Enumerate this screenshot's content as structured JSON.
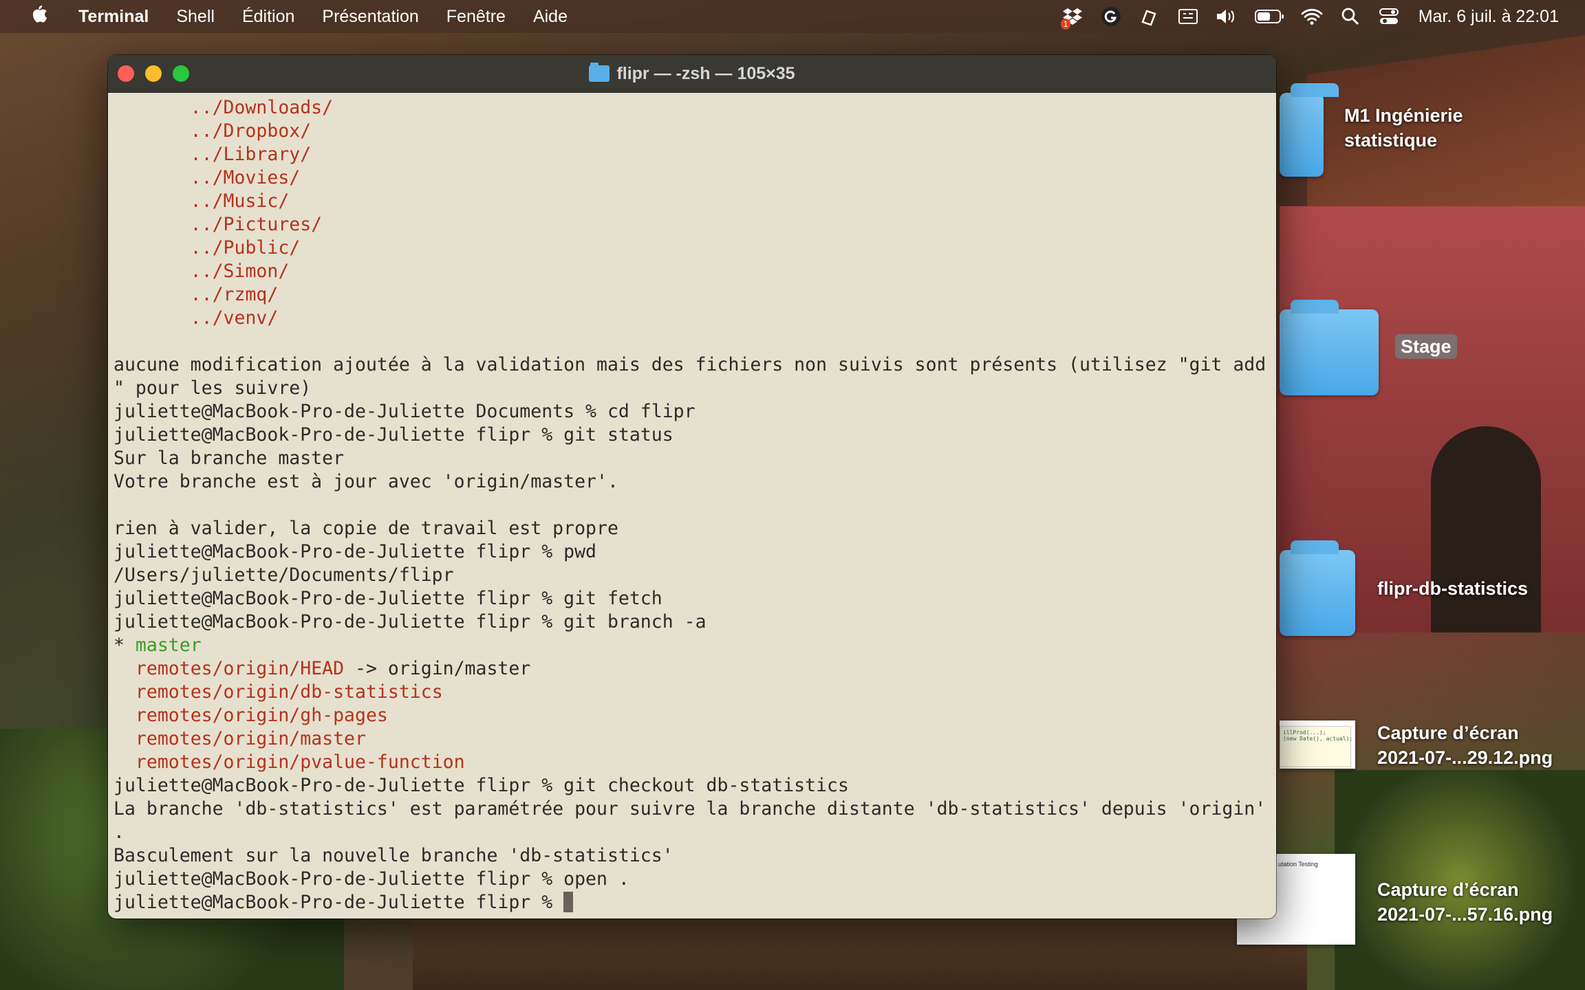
{
  "menubar": {
    "app_name": "Terminal",
    "items": [
      "Shell",
      "Édition",
      "Présentation",
      "Fenêtre",
      "Aide"
    ],
    "status_badge": "1",
    "clock": "Mar. 6 juil. à  22:01",
    "tray_icons": [
      "dropbox-icon",
      "grammarly-icon",
      "pen-icon",
      "keyboard-icon",
      "volume-icon",
      "battery-icon",
      "wifi-icon",
      "search-icon",
      "control-center-icon"
    ]
  },
  "window": {
    "title": "flipr — -zsh — 105×35"
  },
  "terminal": {
    "lines": [
      {
        "segments": [
          {
            "t": "       ../Downloads/",
            "c": "red"
          }
        ]
      },
      {
        "segments": [
          {
            "t": "       ../Dropbox/",
            "c": "red"
          }
        ]
      },
      {
        "segments": [
          {
            "t": "       ../Library/",
            "c": "red"
          }
        ]
      },
      {
        "segments": [
          {
            "t": "       ../Movies/",
            "c": "red"
          }
        ]
      },
      {
        "segments": [
          {
            "t": "       ../Music/",
            "c": "red"
          }
        ]
      },
      {
        "segments": [
          {
            "t": "       ../Pictures/",
            "c": "red"
          }
        ]
      },
      {
        "segments": [
          {
            "t": "       ../Public/",
            "c": "red"
          }
        ]
      },
      {
        "segments": [
          {
            "t": "       ../Simon/",
            "c": "red"
          }
        ]
      },
      {
        "segments": [
          {
            "t": "       ../rzmq/",
            "c": "red"
          }
        ]
      },
      {
        "segments": [
          {
            "t": "       ../venv/",
            "c": "red"
          }
        ]
      },
      {
        "segments": [
          {
            "t": "",
            "c": ""
          }
        ]
      },
      {
        "segments": [
          {
            "t": "aucune modification ajoutée à la validation mais des fichiers non suivis sont présents (utilisez \"git add",
            "c": ""
          }
        ]
      },
      {
        "segments": [
          {
            "t": "\" pour les suivre)",
            "c": ""
          }
        ]
      },
      {
        "segments": [
          {
            "t": "juliette@MacBook-Pro-de-Juliette Documents % cd flipr",
            "c": ""
          }
        ]
      },
      {
        "segments": [
          {
            "t": "juliette@MacBook-Pro-de-Juliette flipr % git status",
            "c": ""
          }
        ]
      },
      {
        "segments": [
          {
            "t": "Sur la branche master",
            "c": ""
          }
        ]
      },
      {
        "segments": [
          {
            "t": "Votre branche est à jour avec 'origin/master'.",
            "c": ""
          }
        ]
      },
      {
        "segments": [
          {
            "t": "",
            "c": ""
          }
        ]
      },
      {
        "segments": [
          {
            "t": "rien à valider, la copie de travail est propre",
            "c": ""
          }
        ]
      },
      {
        "segments": [
          {
            "t": "juliette@MacBook-Pro-de-Juliette flipr % pwd",
            "c": ""
          }
        ]
      },
      {
        "segments": [
          {
            "t": "/Users/juliette/Documents/flipr",
            "c": ""
          }
        ]
      },
      {
        "segments": [
          {
            "t": "juliette@MacBook-Pro-de-Juliette flipr % git fetch",
            "c": ""
          }
        ]
      },
      {
        "segments": [
          {
            "t": "juliette@MacBook-Pro-de-Juliette flipr % git branch -a",
            "c": ""
          }
        ]
      },
      {
        "segments": [
          {
            "t": "* ",
            "c": ""
          },
          {
            "t": "master",
            "c": "green"
          }
        ]
      },
      {
        "segments": [
          {
            "t": "  ",
            "c": ""
          },
          {
            "t": "remotes/origin/HEAD",
            "c": "red"
          },
          {
            "t": " -> origin/master",
            "c": ""
          }
        ]
      },
      {
        "segments": [
          {
            "t": "  ",
            "c": ""
          },
          {
            "t": "remotes/origin/db-statistics",
            "c": "red"
          }
        ]
      },
      {
        "segments": [
          {
            "t": "  ",
            "c": ""
          },
          {
            "t": "remotes/origin/gh-pages",
            "c": "red"
          }
        ]
      },
      {
        "segments": [
          {
            "t": "  ",
            "c": ""
          },
          {
            "t": "remotes/origin/master",
            "c": "red"
          }
        ]
      },
      {
        "segments": [
          {
            "t": "  ",
            "c": ""
          },
          {
            "t": "remotes/origin/pvalue-function",
            "c": "red"
          }
        ]
      },
      {
        "segments": [
          {
            "t": "juliette@MacBook-Pro-de-Juliette flipr % git checkout db-statistics",
            "c": ""
          }
        ]
      },
      {
        "segments": [
          {
            "t": "La branche 'db-statistics' est paramétrée pour suivre la branche distante 'db-statistics' depuis 'origin'",
            "c": ""
          }
        ]
      },
      {
        "segments": [
          {
            "t": ".",
            "c": ""
          }
        ]
      },
      {
        "segments": [
          {
            "t": "Basculement sur la nouvelle branche 'db-statistics'",
            "c": ""
          }
        ]
      },
      {
        "segments": [
          {
            "t": "juliette@MacBook-Pro-de-Juliette flipr % open .",
            "c": ""
          }
        ]
      },
      {
        "segments": [
          {
            "t": "juliette@MacBook-Pro-de-Juliette flipr % ",
            "c": ""
          }
        ],
        "cursor": true
      }
    ]
  },
  "desktop": {
    "items": [
      {
        "label_line1": "M1 Ingénierie",
        "label_line2": "statistique"
      },
      {
        "label_line1": "Stage"
      },
      {
        "label_line1": "flipr-db-statistics"
      },
      {
        "label_line1": "Capture d’écran",
        "label_line2": "2021-07-...29.12.png"
      },
      {
        "label_line1": "Capture d’écran",
        "label_line2": "2021-07-...57.16.png"
      }
    ],
    "thumb1_text": "illProd(...);\n(new Date(), actual);",
    "thumb2_text": "utation Testing"
  }
}
